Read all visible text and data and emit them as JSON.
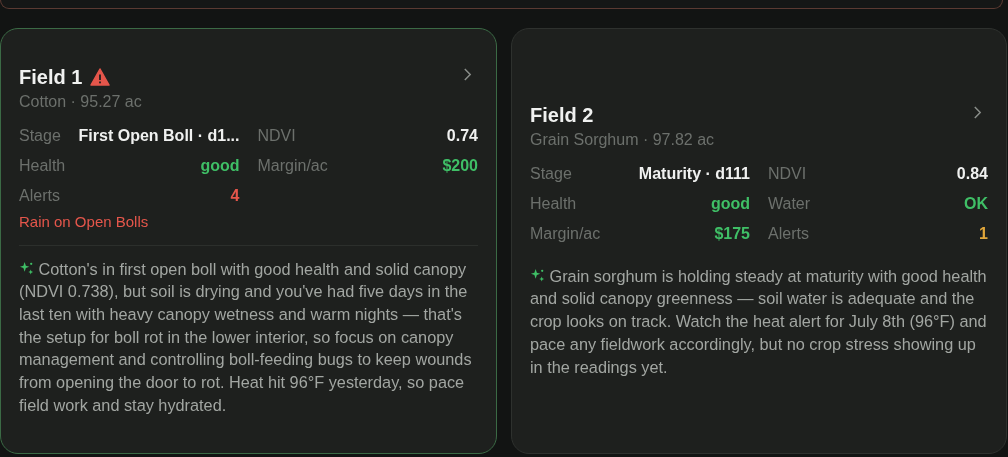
{
  "fields": [
    {
      "name": "Field 1",
      "selected": true,
      "alert_icon": true,
      "subtitle": "Cotton · 95.27 ac",
      "stats": [
        {
          "label": "Stage",
          "value": "First Open Boll · d1...",
          "color": "#f0f1f0"
        },
        {
          "label": "NDVI",
          "value": "0.74",
          "color": "#f0f1f0"
        },
        {
          "label": "Health",
          "value": "good",
          "color": "#3fbf66"
        },
        {
          "label": "Margin/ac",
          "value": "$200",
          "color": "#3fbf66"
        },
        {
          "label": "Alerts",
          "value": "4",
          "color": "#e5564b"
        }
      ],
      "alert": "Rain on Open Bolls",
      "summary": "Cotton's in first open boll with good health and solid canopy (NDVI 0.738), but soil is drying and you've had five days in the last ten with heavy canopy wetness and warm nights — that's the setup for boll rot in the lower interior, so focus on canopy management and controlling boll-feeding bugs to keep wounds from opening the door to rot. Heat hit 96°F yesterday, so pace field work and stay hydrated."
    },
    {
      "name": "Field 2",
      "selected": false,
      "alert_icon": false,
      "subtitle": "Grain Sorghum · 97.82 ac",
      "stats": [
        {
          "label": "Stage",
          "value": "Maturity · d111",
          "color": "#f0f1f0"
        },
        {
          "label": "NDVI",
          "value": "0.84",
          "color": "#f0f1f0"
        },
        {
          "label": "Health",
          "value": "good",
          "color": "#3fbf66"
        },
        {
          "label": "Water",
          "value": "OK",
          "color": "#3fbf66"
        },
        {
          "label": "Margin/ac",
          "value": "$175",
          "color": "#3fbf66"
        },
        {
          "label": "Alerts",
          "value": "1",
          "color": "#e0a63a"
        }
      ],
      "summary": "Grain sorghum is holding steady at maturity with good health and solid canopy greenness — soil water is adequate and the crop looks on track. Watch the heat alert for July 8th (96°F) and pace any fieldwork accordingly, but no crop stress showing up in the readings yet."
    }
  ]
}
